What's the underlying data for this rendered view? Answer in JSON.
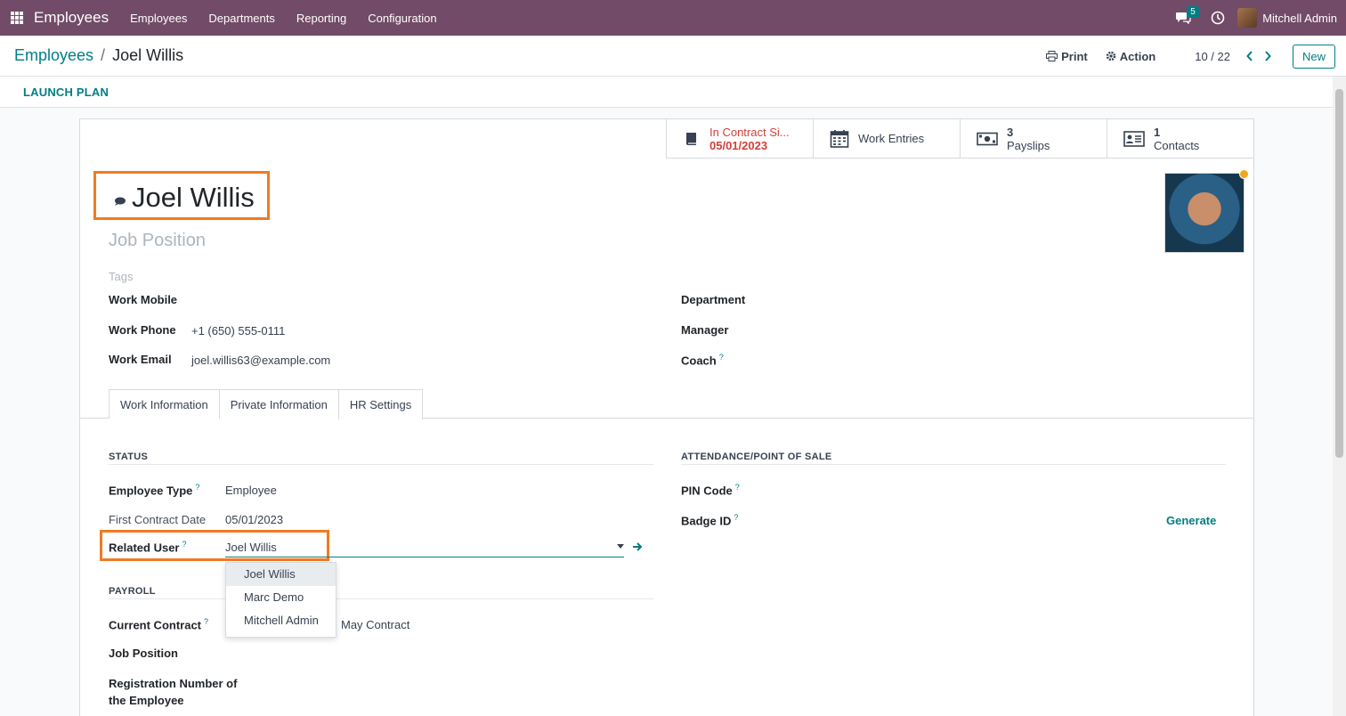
{
  "navbar": {
    "brand": "Employees",
    "menu": [
      "Employees",
      "Departments",
      "Reporting",
      "Configuration"
    ],
    "chat_count": "5",
    "user": "Mitchell Admin"
  },
  "breadcrumb": {
    "parent": "Employees",
    "separator": "/",
    "current": "Joel Willis"
  },
  "control": {
    "print": "Print",
    "action": "Action",
    "pager": "10 / 22",
    "new": "New"
  },
  "statusbar": {
    "launch_plan": "LAUNCH PLAN"
  },
  "smart_buttons": {
    "contract": {
      "line1": "In Contract Si...",
      "line2": "05/01/2023"
    },
    "work_entries": {
      "label": "Work Entries"
    },
    "payslips": {
      "count": "3",
      "label": "Payslips"
    },
    "contacts": {
      "count": "1",
      "label": "Contacts"
    }
  },
  "employee": {
    "name": "Joel Willis",
    "job_position_placeholder": "Job Position",
    "tags_placeholder": "Tags"
  },
  "fields_left": {
    "work_mobile": {
      "label": "Work Mobile",
      "value": ""
    },
    "work_phone": {
      "label": "Work Phone",
      "value": "+1 (650) 555-0111"
    },
    "work_email": {
      "label": "Work Email",
      "value": "joel.willis63@example.com"
    }
  },
  "fields_right": {
    "department": "Department",
    "manager": "Manager",
    "coach": "Coach"
  },
  "tabs": [
    "Work Information",
    "Private Information",
    "HR Settings"
  ],
  "hr_settings": {
    "status_title": "STATUS",
    "employee_type": {
      "label": "Employee Type",
      "value": "Employee"
    },
    "first_contract_date": {
      "label": "First Contract Date",
      "value": "05/01/2023"
    },
    "related_user": {
      "label": "Related User",
      "value": "Joel Willis"
    },
    "payroll_title": "PAYROLL",
    "current_contract": {
      "label": "Current Contract",
      "value": "May Contract"
    },
    "job_position": {
      "label": "Job Position"
    },
    "registration_number": {
      "label_line1": "Registration Number of",
      "label_line2": "the Employee"
    },
    "attendance_title": "ATTENDANCE/POINT OF SALE",
    "pin_code": {
      "label": "PIN Code"
    },
    "badge_id": {
      "label": "Badge ID",
      "action": "Generate"
    },
    "help_mark": "?"
  },
  "dropdown": {
    "options": [
      "Joel Willis",
      "Marc Demo",
      "Mitchell Admin"
    ]
  }
}
